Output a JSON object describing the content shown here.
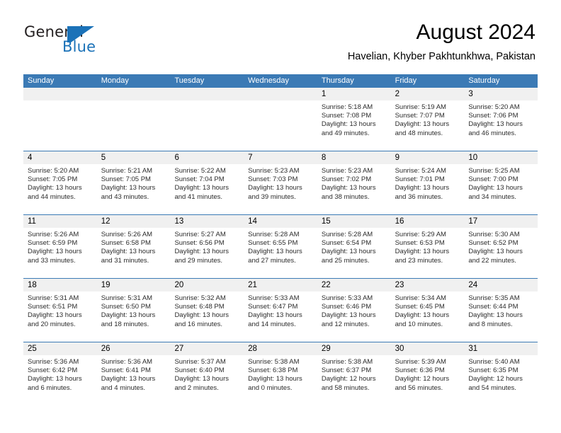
{
  "brand": {
    "name_top": "General",
    "name_bottom": "Blue",
    "logo_icon": "flag-triangle-icon",
    "accent_color": "#1b72b8"
  },
  "header": {
    "title": "August 2024",
    "subtitle": "Havelian, Khyber Pakhtunkhwa, Pakistan"
  },
  "colors": {
    "header_blue": "#3b7ab5",
    "daynum_band": "#f0f0f0",
    "text": "#000000"
  },
  "weekdays": [
    "Sunday",
    "Monday",
    "Tuesday",
    "Wednesday",
    "Thursday",
    "Friday",
    "Saturday"
  ],
  "weeks": [
    [
      {
        "day": "",
        "sunrise": "",
        "sunset": "",
        "daylight1": "",
        "daylight2": ""
      },
      {
        "day": "",
        "sunrise": "",
        "sunset": "",
        "daylight1": "",
        "daylight2": ""
      },
      {
        "day": "",
        "sunrise": "",
        "sunset": "",
        "daylight1": "",
        "daylight2": ""
      },
      {
        "day": "",
        "sunrise": "",
        "sunset": "",
        "daylight1": "",
        "daylight2": ""
      },
      {
        "day": "1",
        "sunrise": "Sunrise: 5:18 AM",
        "sunset": "Sunset: 7:08 PM",
        "daylight1": "Daylight: 13 hours",
        "daylight2": "and 49 minutes."
      },
      {
        "day": "2",
        "sunrise": "Sunrise: 5:19 AM",
        "sunset": "Sunset: 7:07 PM",
        "daylight1": "Daylight: 13 hours",
        "daylight2": "and 48 minutes."
      },
      {
        "day": "3",
        "sunrise": "Sunrise: 5:20 AM",
        "sunset": "Sunset: 7:06 PM",
        "daylight1": "Daylight: 13 hours",
        "daylight2": "and 46 minutes."
      }
    ],
    [
      {
        "day": "4",
        "sunrise": "Sunrise: 5:20 AM",
        "sunset": "Sunset: 7:05 PM",
        "daylight1": "Daylight: 13 hours",
        "daylight2": "and 44 minutes."
      },
      {
        "day": "5",
        "sunrise": "Sunrise: 5:21 AM",
        "sunset": "Sunset: 7:05 PM",
        "daylight1": "Daylight: 13 hours",
        "daylight2": "and 43 minutes."
      },
      {
        "day": "6",
        "sunrise": "Sunrise: 5:22 AM",
        "sunset": "Sunset: 7:04 PM",
        "daylight1": "Daylight: 13 hours",
        "daylight2": "and 41 minutes."
      },
      {
        "day": "7",
        "sunrise": "Sunrise: 5:23 AM",
        "sunset": "Sunset: 7:03 PM",
        "daylight1": "Daylight: 13 hours",
        "daylight2": "and 39 minutes."
      },
      {
        "day": "8",
        "sunrise": "Sunrise: 5:23 AM",
        "sunset": "Sunset: 7:02 PM",
        "daylight1": "Daylight: 13 hours",
        "daylight2": "and 38 minutes."
      },
      {
        "day": "9",
        "sunrise": "Sunrise: 5:24 AM",
        "sunset": "Sunset: 7:01 PM",
        "daylight1": "Daylight: 13 hours",
        "daylight2": "and 36 minutes."
      },
      {
        "day": "10",
        "sunrise": "Sunrise: 5:25 AM",
        "sunset": "Sunset: 7:00 PM",
        "daylight1": "Daylight: 13 hours",
        "daylight2": "and 34 minutes."
      }
    ],
    [
      {
        "day": "11",
        "sunrise": "Sunrise: 5:26 AM",
        "sunset": "Sunset: 6:59 PM",
        "daylight1": "Daylight: 13 hours",
        "daylight2": "and 33 minutes."
      },
      {
        "day": "12",
        "sunrise": "Sunrise: 5:26 AM",
        "sunset": "Sunset: 6:58 PM",
        "daylight1": "Daylight: 13 hours",
        "daylight2": "and 31 minutes."
      },
      {
        "day": "13",
        "sunrise": "Sunrise: 5:27 AM",
        "sunset": "Sunset: 6:56 PM",
        "daylight1": "Daylight: 13 hours",
        "daylight2": "and 29 minutes."
      },
      {
        "day": "14",
        "sunrise": "Sunrise: 5:28 AM",
        "sunset": "Sunset: 6:55 PM",
        "daylight1": "Daylight: 13 hours",
        "daylight2": "and 27 minutes."
      },
      {
        "day": "15",
        "sunrise": "Sunrise: 5:28 AM",
        "sunset": "Sunset: 6:54 PM",
        "daylight1": "Daylight: 13 hours",
        "daylight2": "and 25 minutes."
      },
      {
        "day": "16",
        "sunrise": "Sunrise: 5:29 AM",
        "sunset": "Sunset: 6:53 PM",
        "daylight1": "Daylight: 13 hours",
        "daylight2": "and 23 minutes."
      },
      {
        "day": "17",
        "sunrise": "Sunrise: 5:30 AM",
        "sunset": "Sunset: 6:52 PM",
        "daylight1": "Daylight: 13 hours",
        "daylight2": "and 22 minutes."
      }
    ],
    [
      {
        "day": "18",
        "sunrise": "Sunrise: 5:31 AM",
        "sunset": "Sunset: 6:51 PM",
        "daylight1": "Daylight: 13 hours",
        "daylight2": "and 20 minutes."
      },
      {
        "day": "19",
        "sunrise": "Sunrise: 5:31 AM",
        "sunset": "Sunset: 6:50 PM",
        "daylight1": "Daylight: 13 hours",
        "daylight2": "and 18 minutes."
      },
      {
        "day": "20",
        "sunrise": "Sunrise: 5:32 AM",
        "sunset": "Sunset: 6:48 PM",
        "daylight1": "Daylight: 13 hours",
        "daylight2": "and 16 minutes."
      },
      {
        "day": "21",
        "sunrise": "Sunrise: 5:33 AM",
        "sunset": "Sunset: 6:47 PM",
        "daylight1": "Daylight: 13 hours",
        "daylight2": "and 14 minutes."
      },
      {
        "day": "22",
        "sunrise": "Sunrise: 5:33 AM",
        "sunset": "Sunset: 6:46 PM",
        "daylight1": "Daylight: 13 hours",
        "daylight2": "and 12 minutes."
      },
      {
        "day": "23",
        "sunrise": "Sunrise: 5:34 AM",
        "sunset": "Sunset: 6:45 PM",
        "daylight1": "Daylight: 13 hours",
        "daylight2": "and 10 minutes."
      },
      {
        "day": "24",
        "sunrise": "Sunrise: 5:35 AM",
        "sunset": "Sunset: 6:44 PM",
        "daylight1": "Daylight: 13 hours",
        "daylight2": "and 8 minutes."
      }
    ],
    [
      {
        "day": "25",
        "sunrise": "Sunrise: 5:36 AM",
        "sunset": "Sunset: 6:42 PM",
        "daylight1": "Daylight: 13 hours",
        "daylight2": "and 6 minutes."
      },
      {
        "day": "26",
        "sunrise": "Sunrise: 5:36 AM",
        "sunset": "Sunset: 6:41 PM",
        "daylight1": "Daylight: 13 hours",
        "daylight2": "and 4 minutes."
      },
      {
        "day": "27",
        "sunrise": "Sunrise: 5:37 AM",
        "sunset": "Sunset: 6:40 PM",
        "daylight1": "Daylight: 13 hours",
        "daylight2": "and 2 minutes."
      },
      {
        "day": "28",
        "sunrise": "Sunrise: 5:38 AM",
        "sunset": "Sunset: 6:38 PM",
        "daylight1": "Daylight: 13 hours",
        "daylight2": "and 0 minutes."
      },
      {
        "day": "29",
        "sunrise": "Sunrise: 5:38 AM",
        "sunset": "Sunset: 6:37 PM",
        "daylight1": "Daylight: 12 hours",
        "daylight2": "and 58 minutes."
      },
      {
        "day": "30",
        "sunrise": "Sunrise: 5:39 AM",
        "sunset": "Sunset: 6:36 PM",
        "daylight1": "Daylight: 12 hours",
        "daylight2": "and 56 minutes."
      },
      {
        "day": "31",
        "sunrise": "Sunrise: 5:40 AM",
        "sunset": "Sunset: 6:35 PM",
        "daylight1": "Daylight: 12 hours",
        "daylight2": "and 54 minutes."
      }
    ]
  ]
}
